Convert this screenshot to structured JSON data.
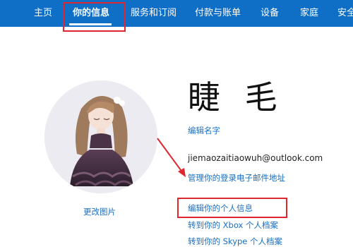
{
  "nav": {
    "items": [
      "主页",
      "你的信息",
      "服务和订阅",
      "付款与账单",
      "设备",
      "家庭",
      "安全"
    ],
    "active": "你的信息"
  },
  "profile": {
    "name": "睫 毛",
    "edit_name_link": "编辑名字",
    "email": "jiemaozaitiaowuh@outlook.com",
    "manage_email_link": "管理你的登录电子邮件地址",
    "change_picture_link": "更改图片",
    "edit_personal_info_link": "编辑你的个人信息",
    "xbox_profile_link": "转到你的 Xbox 个人档案",
    "skype_profile_link": "转到你的 Skype 个人档案"
  },
  "colors": {
    "nav_bg": "#0f6fc6",
    "link": "#1a6fc1",
    "highlight": "#e0262e"
  }
}
